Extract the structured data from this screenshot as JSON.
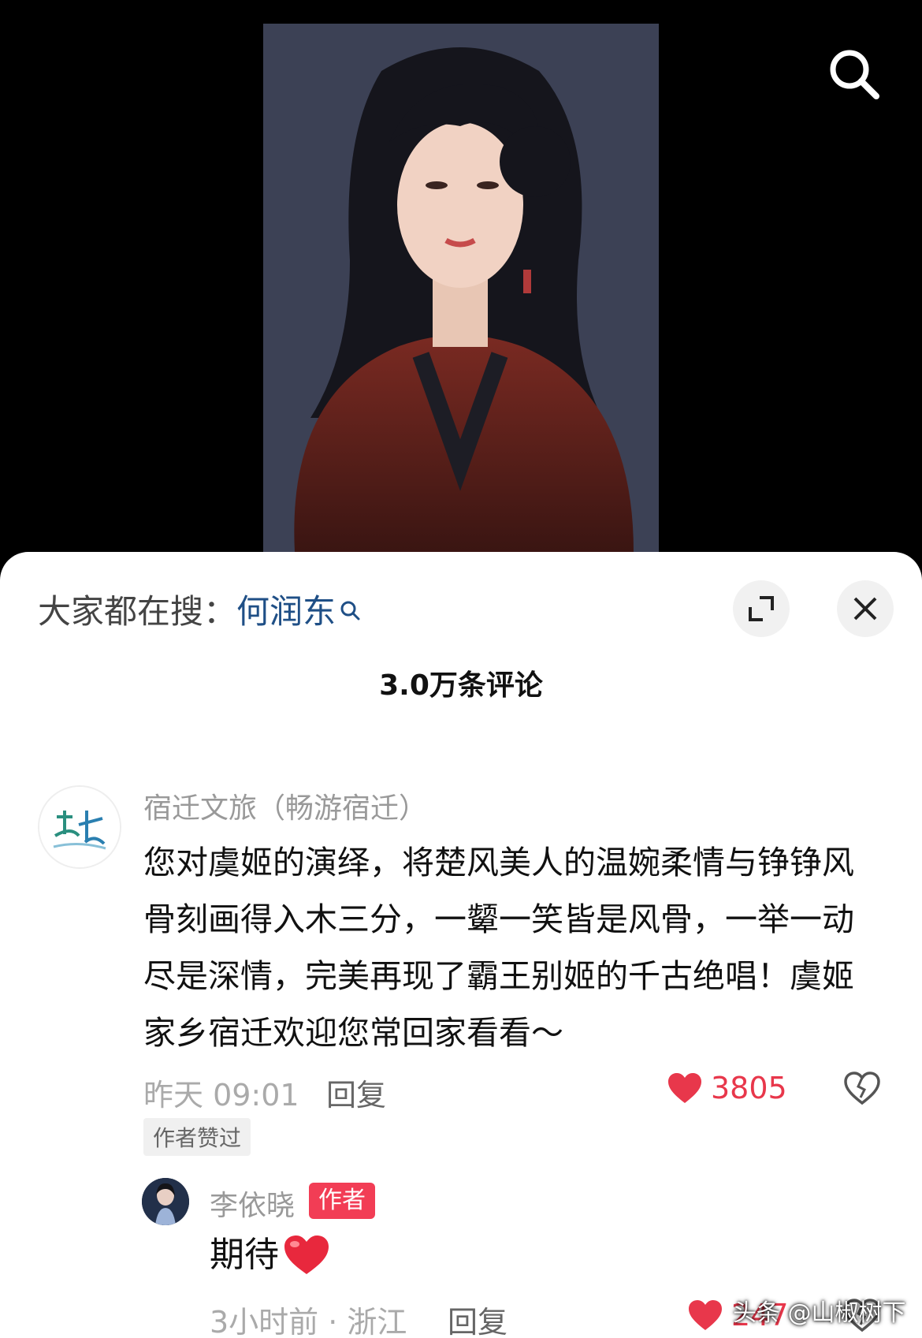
{
  "header": {
    "trending_prefix": "大家都在搜：",
    "trending_term": "何润东"
  },
  "comments_header": {
    "count_label": "3.0万条评论"
  },
  "comment_1": {
    "username": "宿迁文旅（畅游宿迁）",
    "text": "您对虞姬的演绎，将楚风美人的温婉柔情与铮铮风骨刻画得入木三分，一颦一笑皆是风骨，一举一动尽是深情，完美再现了霸王别姬的千古绝唱！虞姬家乡宿迁欢迎您常回家看看～",
    "time": "昨天 09:01",
    "reply_label": "回复",
    "like_count": "3805",
    "author_liked": "作者赞过"
  },
  "comment_2": {
    "username": "李依晓",
    "author_badge": "作者",
    "text": "期待",
    "time": "3小时前 · 浙江",
    "reply_label": "回复",
    "like_count": "247"
  },
  "watermark": "头条 @山椒树下",
  "colors": {
    "accent_red": "#e8374b",
    "link_blue": "#1f4f86"
  }
}
